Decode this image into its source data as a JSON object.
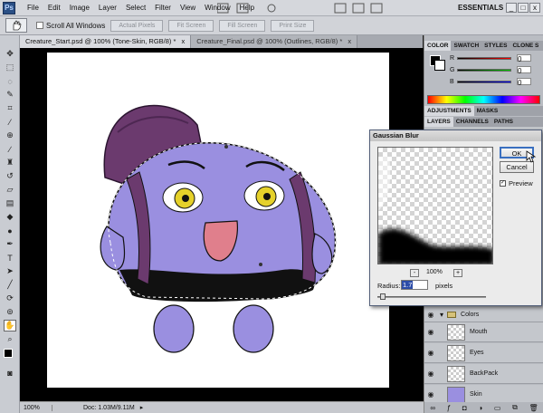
{
  "app": {
    "logo": "Ps",
    "workspace": "ESSENTIALS",
    "window_buttons": [
      "_",
      "□",
      "x"
    ]
  },
  "menu": [
    "File",
    "Edit",
    "Image",
    "Layer",
    "Select",
    "Filter",
    "View",
    "Window",
    "Help"
  ],
  "options": {
    "tool_icon": "hand-icon",
    "scroll_all_windows": "Scroll All Windows",
    "buttons": [
      "Actual Pixels",
      "Fit Screen",
      "Fill Screen",
      "Print Size"
    ]
  },
  "doc_tabs": [
    {
      "label": "Creature_Start.psd @ 100% (Tone-Skin, RGB/8) *",
      "close": "x",
      "active": true
    },
    {
      "label": "Creature_Final.psd @ 100% (Outlines, RGB/8) *",
      "close": "x",
      "active": false
    }
  ],
  "status": {
    "zoom": "100%",
    "doc": "Doc: 1.03M/9.11M"
  },
  "color_panel": {
    "tabs": [
      "COLOR",
      "SWATCH",
      "STYLES",
      "CLONE S"
    ],
    "channels": [
      "R",
      "G",
      "B"
    ],
    "values": [
      "0",
      "0",
      "0"
    ]
  },
  "adjust_panel": {
    "tabs": [
      "ADJUSTMENTS",
      "MASKS"
    ]
  },
  "layers_panel": {
    "tabs": [
      "LAYERS",
      "CHANNELS",
      "PATHS"
    ],
    "group": "Colors",
    "layers": [
      "Mouth",
      "Eyes",
      "BackPack",
      "Skin"
    ]
  },
  "dialog": {
    "title": "Gaussian Blur",
    "ok": "OK",
    "cancel": "Cancel",
    "preview": "Preview",
    "zoom": "100%",
    "zoom_minus": "-",
    "zoom_plus": "+",
    "radius_label": "Radius:",
    "radius_value": "1.7",
    "radius_unit": "pixels",
    "radius_slider_fraction": 0.05
  },
  "colors": {
    "accent": "#7f7fd6",
    "backpack": "#6b3a6e",
    "panel_bg": "#c9ccd2"
  }
}
